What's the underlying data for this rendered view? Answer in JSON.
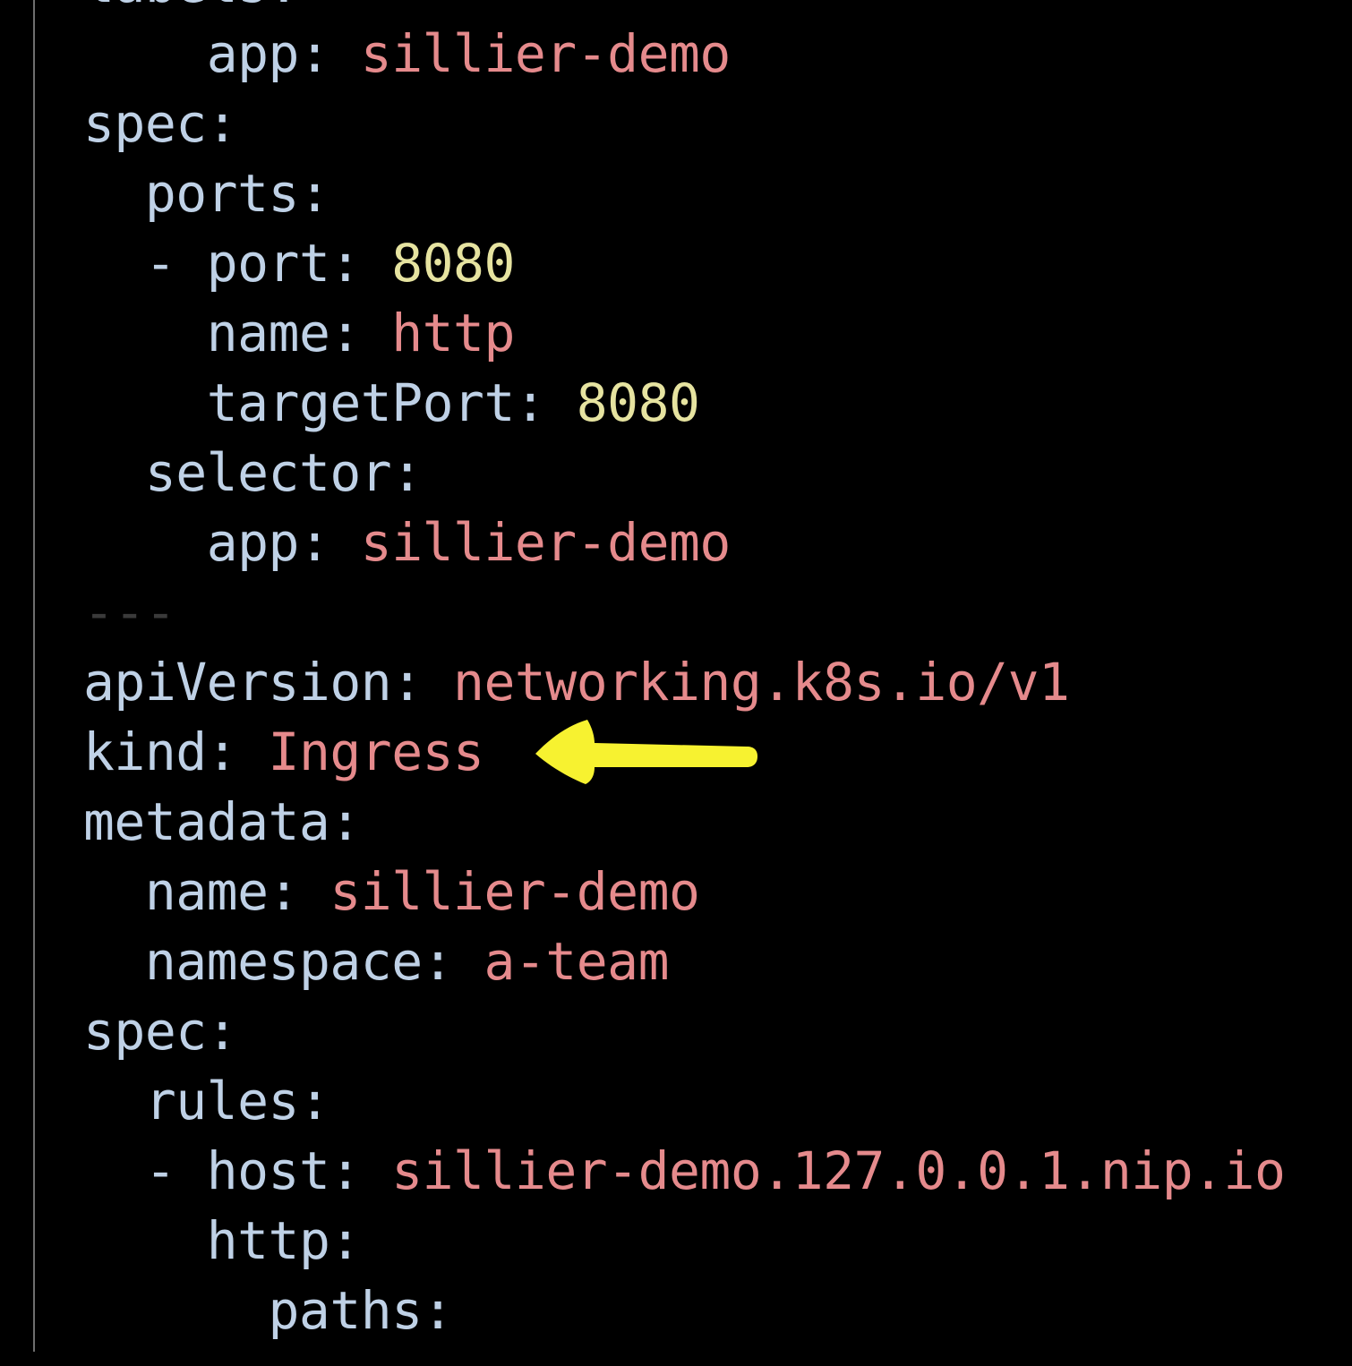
{
  "colors": {
    "background": "#000000",
    "key": "#bfd1e6",
    "string": "#e58a8c",
    "number": "#e6e3a0",
    "separator": "#3a3a3a",
    "arrow": "#f7f230"
  },
  "annotation": {
    "icon": "arrow-left-icon",
    "points_to_line": 11
  },
  "code_lines": [
    {
      "indent": "",
      "dash": "",
      "key": "labels",
      "value": "",
      "vtype": "s"
    },
    {
      "indent": "    ",
      "dash": "",
      "key": "app",
      "value": "sillier-demo",
      "vtype": "s"
    },
    {
      "indent": "",
      "dash": "",
      "key": "spec",
      "value": "",
      "vtype": "s"
    },
    {
      "indent": "  ",
      "dash": "",
      "key": "ports",
      "value": "",
      "vtype": "s"
    },
    {
      "indent": "  ",
      "dash": "- ",
      "key": "port",
      "value": "8080",
      "vtype": "n"
    },
    {
      "indent": "    ",
      "dash": "",
      "key": "name",
      "value": "http",
      "vtype": "s"
    },
    {
      "indent": "    ",
      "dash": "",
      "key": "targetPort",
      "value": "8080",
      "vtype": "n"
    },
    {
      "indent": "  ",
      "dash": "",
      "key": "selector",
      "value": "",
      "vtype": "s"
    },
    {
      "indent": "    ",
      "dash": "",
      "key": "app",
      "value": "sillier-demo",
      "vtype": "s"
    },
    {
      "indent": "",
      "dash": "",
      "key": "",
      "value": "",
      "vtype": "s",
      "separator": "---"
    },
    {
      "indent": "",
      "dash": "",
      "key": "apiVersion",
      "value": "networking.k8s.io/v1",
      "vtype": "s"
    },
    {
      "indent": "",
      "dash": "",
      "key": "kind",
      "value": "Ingress",
      "vtype": "s"
    },
    {
      "indent": "",
      "dash": "",
      "key": "metadata",
      "value": "",
      "vtype": "s"
    },
    {
      "indent": "  ",
      "dash": "",
      "key": "name",
      "value": "sillier-demo",
      "vtype": "s"
    },
    {
      "indent": "  ",
      "dash": "",
      "key": "namespace",
      "value": "a-team",
      "vtype": "s"
    },
    {
      "indent": "",
      "dash": "",
      "key": "spec",
      "value": "",
      "vtype": "s"
    },
    {
      "indent": "  ",
      "dash": "",
      "key": "rules",
      "value": "",
      "vtype": "s"
    },
    {
      "indent": "  ",
      "dash": "- ",
      "key": "host",
      "value": "sillier-demo.127.0.0.1.nip.io",
      "vtype": "s"
    },
    {
      "indent": "    ",
      "dash": "",
      "key": "http",
      "value": "",
      "vtype": "s"
    },
    {
      "indent": "      ",
      "dash": "",
      "key": "paths",
      "value": "",
      "vtype": "s"
    }
  ]
}
